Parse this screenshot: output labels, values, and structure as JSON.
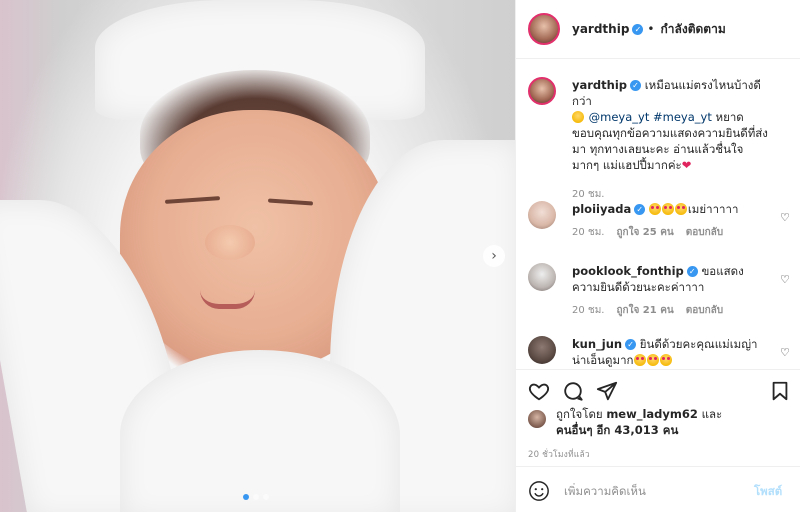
{
  "post": {
    "author": "yardthip",
    "follow_status": "กำลังติดตาม",
    "caption_line1": "เหมือนแม่ตรงไหนบ้างดีกว่า",
    "caption_tag1": "@meya_yt",
    "caption_tag2": "#meya_yt",
    "caption_tail": "หยาด",
    "caption_line2": "ขอบคุณทุกข้อความแสดงความยินดีที่ส่งมา ทุกทางเลยนะคะ อ่านแล้วชื่นใจมากๆ แม่แฮปปี้มากค่ะ",
    "caption_time": "20 ชม.",
    "carousel": {
      "total": 3,
      "active": 1
    }
  },
  "comments": [
    {
      "user": "ploiiyada",
      "text": "เมย่าาาาา",
      "time": "20 ชม.",
      "likes": "ถูกใจ 25 คน",
      "reply": "ตอบกลับ",
      "avatar_color": "#d9b7a7"
    },
    {
      "user": "pooklook_fonthip",
      "text": "ขอแสดงความยินดีด้วยนะคะค่าาาา",
      "time": "20 ชม.",
      "likes": "ถูกใจ 21 คน",
      "reply": "ตอบกลับ",
      "avatar_color": "#cfc9c5"
    },
    {
      "user": "kun_jun",
      "text": "ยินดีด้วยคะคุณแม่เมญ่า น่าเอ็นดูมาก",
      "time": "",
      "likes": "",
      "reply": "",
      "avatar_color": "#5b4a44"
    }
  ],
  "likes_summary": {
    "prefix": "ถูกใจโดย",
    "liker": "mew_ladym62",
    "and": "และ",
    "others": "คนอื่นๆ อีก 43,013 คน"
  },
  "time_ago": "20 ชั่วโมงที่แล้ว",
  "add_comment": {
    "placeholder": "เพิ่มความคิดเห็น",
    "post_label": "โพสต์"
  },
  "colors": {
    "verified": "#3897f0",
    "link": "#00376b",
    "post_disabled": "#b2dffc",
    "ring": "#e1306c"
  },
  "icons": {
    "like": "heart-icon",
    "comment": "comment-bubble-icon",
    "share": "paper-plane-icon",
    "save": "bookmark-icon",
    "emoji": "smile-icon",
    "next": "chevron-right-icon"
  }
}
